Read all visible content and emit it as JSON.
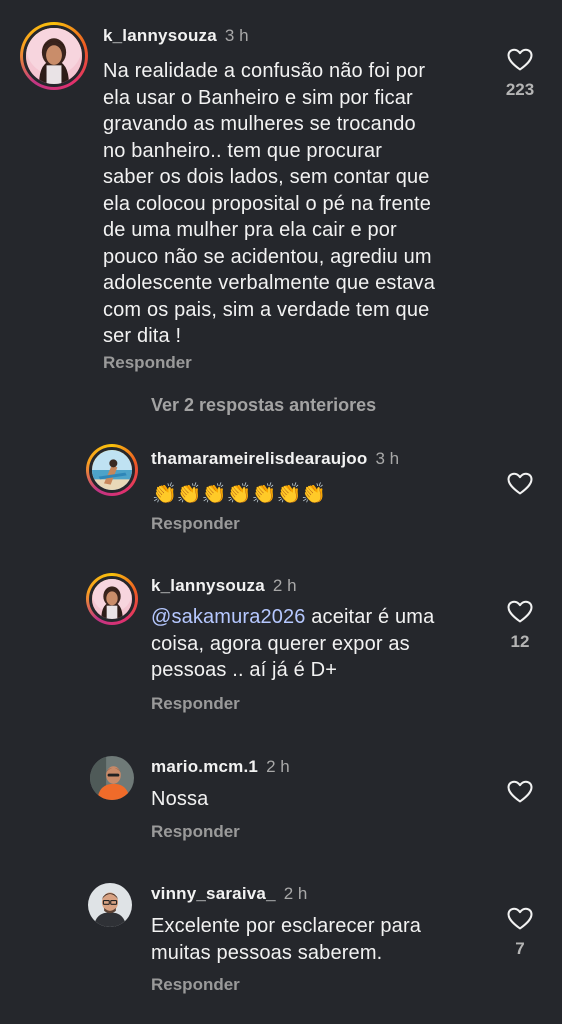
{
  "comments": [
    {
      "username": "k_lannysouza",
      "time": "3 h",
      "text": "Na realidade a confusão não foi por\nela usar o Banheiro e sim por ficar\ngravando as mulheres se trocando\nno banheiro.. tem que procurar\nsaber os dois lados, sem contar que\nela colocou proposital o pé na frente\nde uma mulher pra ela cair e por\npouco não se acidentou, agrediu um\nadolescente verbalmente que estava\ncom os pais, sim a verdade tem que\nser dita !",
      "reply_label": "Responder",
      "likes": "223",
      "avatar_icon": "profile-photo-woman"
    },
    {
      "username": "thamarameirelisdearaujoo",
      "time": "3 h",
      "text": "👏👏👏👏👏👏👏",
      "reply_label": "Responder",
      "likes": "",
      "avatar_icon": "profile-photo-beach"
    },
    {
      "username": "k_lannysouza",
      "time": "2 h",
      "mention": "@sakamura2026",
      "text": " aceitar é uma\ncoisa, agora querer expor as\npessoas .. aí já é D+",
      "reply_label": "Responder",
      "likes": "12",
      "avatar_icon": "profile-photo-woman"
    },
    {
      "username": "mario.mcm.1",
      "time": "2 h",
      "text": "Nossa",
      "reply_label": "Responder",
      "likes": "",
      "avatar_icon": "profile-photo-man-orange"
    },
    {
      "username": "vinny_saraiva_",
      "time": "2 h",
      "text": "Excelente por esclarecer para\nmuitas pessoas saberem.",
      "reply_label": "Responder",
      "likes": "7",
      "avatar_icon": "profile-photo-man-glasses"
    }
  ],
  "view_replies_label": "Ver 2 respostas anteriores",
  "colors": {
    "background": "#25272c",
    "text": "#f2f2f2",
    "secondary": "#a8a8a8",
    "mention": "#b6c8ff"
  }
}
